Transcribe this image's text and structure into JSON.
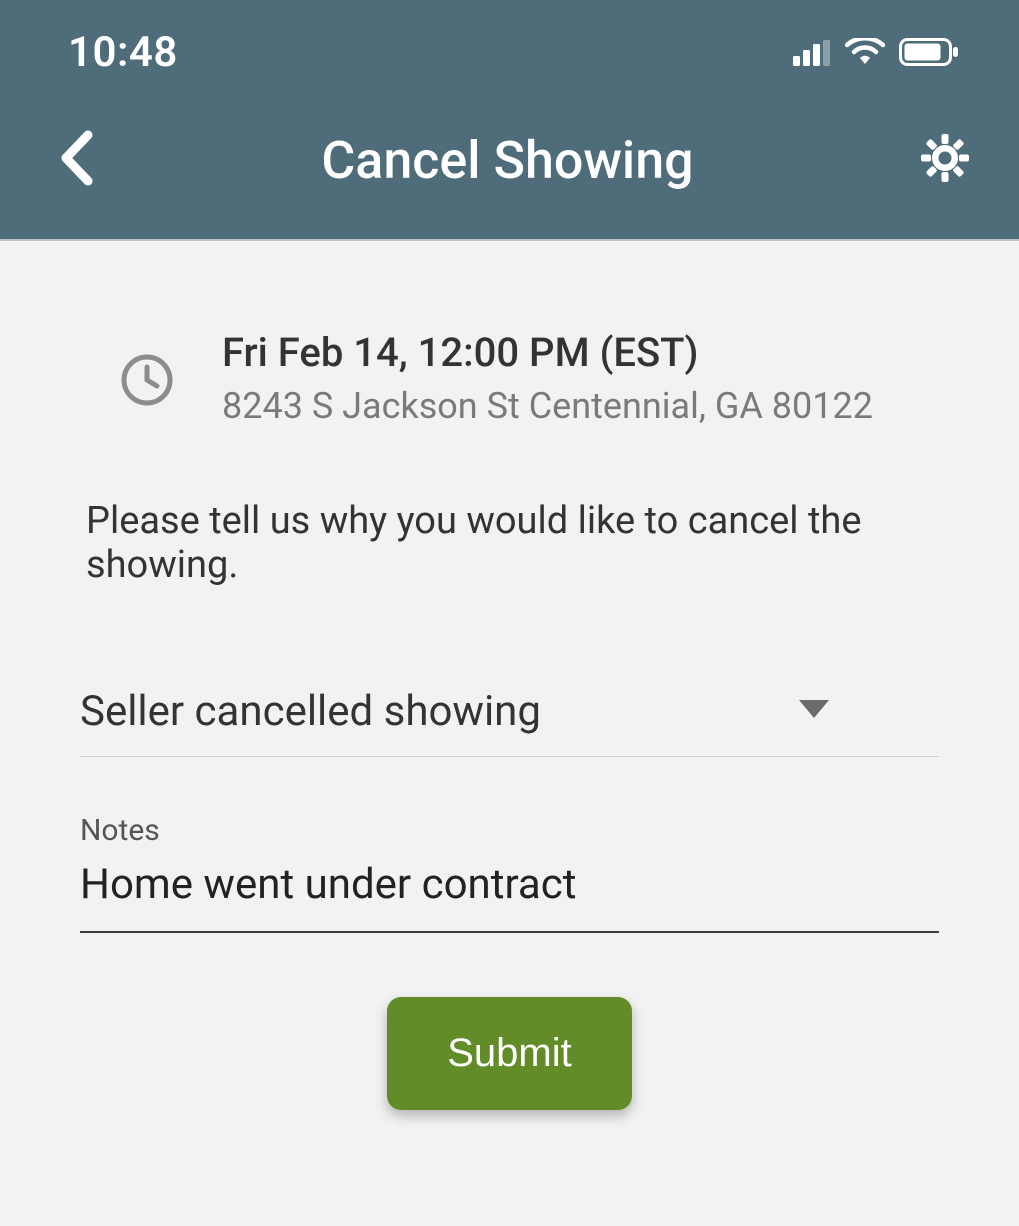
{
  "statusBar": {
    "time": "10:48"
  },
  "nav": {
    "title": "Cancel Showing"
  },
  "showing": {
    "datetime": "Fri Feb 14, 12:00 PM (EST)",
    "address": "8243 S Jackson St  Centennial, GA 80122"
  },
  "prompt": "Please tell us why you would like to cancel the showing.",
  "reason": {
    "selected": "Seller cancelled showing"
  },
  "notes": {
    "label": "Notes",
    "value": "Home went under contract"
  },
  "submit": {
    "label": "Submit"
  }
}
